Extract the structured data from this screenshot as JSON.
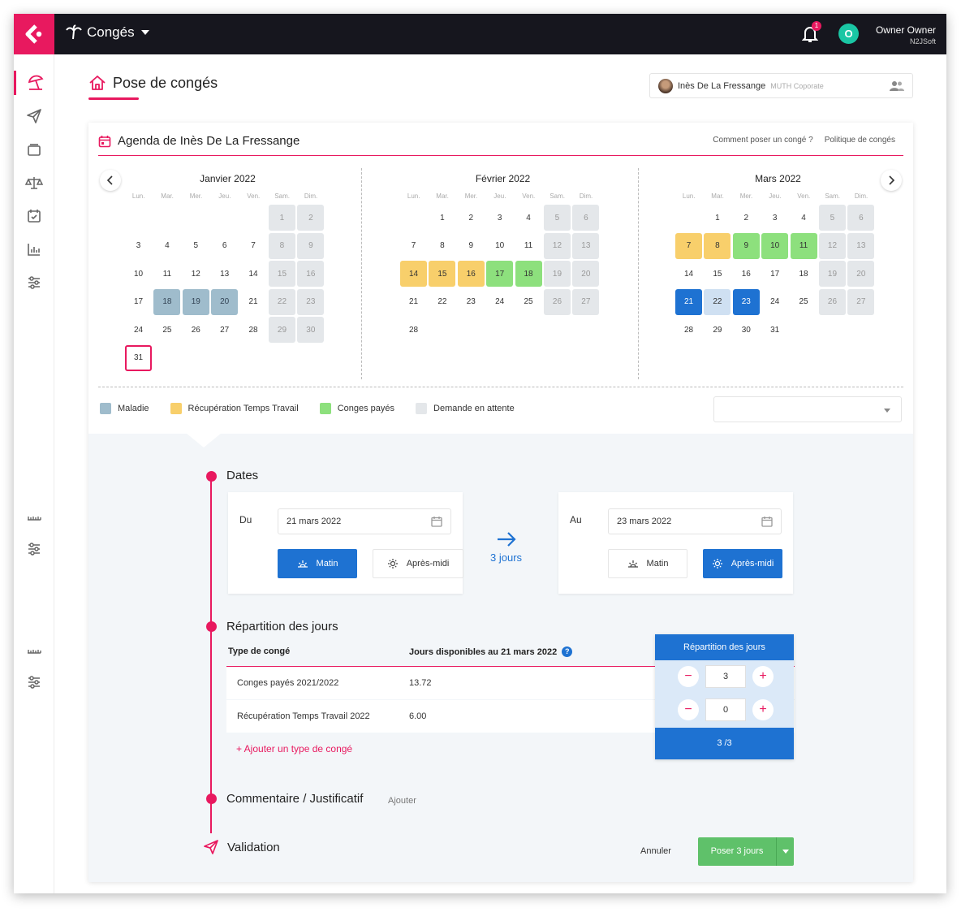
{
  "topbar": {
    "module": "Congés",
    "notifications": "1",
    "avatar_initial": "O",
    "user_name": "Owner Owner",
    "user_company": "N2JSoft"
  },
  "page": {
    "title": "Pose de congés"
  },
  "employee": {
    "name": "Inès De La Fressange",
    "company": "MUTH Coporate"
  },
  "agenda": {
    "title": "Agenda de Inès De La Fressange",
    "link_how": "Comment poser un congé ?",
    "link_policy": "Politique de congés"
  },
  "weekdays": [
    "Lun.",
    "Mar.",
    "Mer.",
    "Jeu.",
    "Ven.",
    "Sam.",
    "Dim."
  ],
  "months": [
    {
      "title": "Janvier 2022",
      "offset": 5,
      "days": 31,
      "weekend_cols": [
        5,
        6
      ],
      "types": {
        "18": "sick",
        "19": "sick",
        "20": "sick",
        "31": "today"
      }
    },
    {
      "title": "Février 2022",
      "offset": 1,
      "days": 28,
      "weekend_cols": [
        5,
        6
      ],
      "types": {
        "14": "rtt",
        "15": "rtt",
        "16": "rtt",
        "17": "paid",
        "18": "paid"
      }
    },
    {
      "title": "Mars 2022",
      "offset": 1,
      "days": 31,
      "weekend_cols": [
        5,
        6
      ],
      "types": {
        "7": "rtt",
        "8": "rtt",
        "9": "paid",
        "10": "paid",
        "11": "paid",
        "21": "sel",
        "22": "pend",
        "23": "sel"
      }
    }
  ],
  "legend": [
    {
      "label": "Maladie",
      "color": "#9fbccc"
    },
    {
      "label": "Récupération Temps Travail",
      "color": "#f8cf6b"
    },
    {
      "label": "Conges payés",
      "color": "#8de07d"
    },
    {
      "label": "Demande en attente",
      "color": "#e4e7ea"
    }
  ],
  "dates": {
    "section_title": "Dates",
    "from_label": "Du",
    "from_value": "21 mars 2022",
    "to_label": "Au",
    "to_value": "23 mars 2022",
    "morning": "Matin",
    "afternoon": "Après-midi",
    "duration": "3 jours"
  },
  "repartition": {
    "section_title": "Répartition des jours",
    "col_type": "Type de congé",
    "col_available": "Jours disponibles au 21 mars 2022",
    "help": "?",
    "panel_title": "Répartition des jours",
    "rows": [
      {
        "type": "Conges payés 2021/2022",
        "available": "13.72",
        "value": "3"
      },
      {
        "type": "Récupération Temps Travail 2022",
        "available": "6.00",
        "value": "0"
      }
    ],
    "total": "3 /3",
    "add_type": "+ Ajouter un type de congé"
  },
  "comment": {
    "section_title": "Commentaire / Justificatif",
    "add": "Ajouter"
  },
  "validation": {
    "section_title": "Validation",
    "cancel": "Annuler",
    "submit": "Poser 3 jours"
  }
}
